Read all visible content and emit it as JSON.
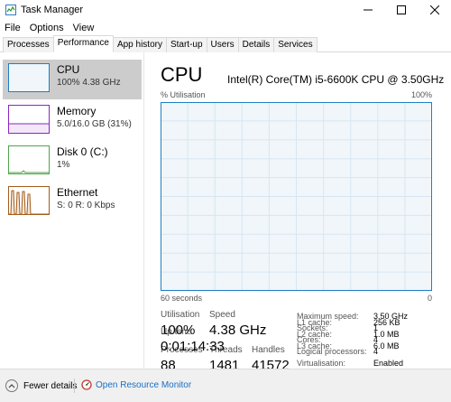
{
  "window": {
    "title": "Task Manager"
  },
  "menu": [
    "File",
    "Options",
    "View"
  ],
  "tabs": [
    {
      "label": "Processes"
    },
    {
      "label": "Performance",
      "active": true
    },
    {
      "label": "App history"
    },
    {
      "label": "Start-up"
    },
    {
      "label": "Users"
    },
    {
      "label": "Details"
    },
    {
      "label": "Services"
    }
  ],
  "sidebar": {
    "items": [
      {
        "name": "CPU",
        "sub": "100% 4.38 GHz",
        "color": "#1f7fc4",
        "selected": true
      },
      {
        "name": "Memory",
        "sub": "5.0/16.0 GB (31%)",
        "color": "#8b26c3"
      },
      {
        "name": "Disk 0 (C:)",
        "sub": "1%",
        "color": "#4ca64c"
      },
      {
        "name": "Ethernet",
        "sub": "S: 0 R: 0 Kbps",
        "color": "#a35c1c"
      }
    ]
  },
  "cpu": {
    "title": "CPU",
    "model": "Intel(R) Core(TM) i5-6600K CPU @ 3.50GHz",
    "util_label": "% Utilisation",
    "util_max": "100%",
    "time_left": "60 seconds",
    "time_right": "0",
    "graph_color": "#1f7fc4",
    "graph_fill": "#f1f6fa",
    "graph_grid": "#d7e6f2",
    "stats": {
      "utilisation_label": "Utilisation",
      "utilisation_value": "100%",
      "speed_label": "Speed",
      "speed_value": "4.38 GHz",
      "processes_label": "Processes",
      "processes_value": "88",
      "threads_label": "Threads",
      "threads_value": "1481",
      "handles_label": "Handles",
      "handles_value": "41572",
      "uptime_label": "Up time",
      "uptime_value": "0:01:14:33"
    },
    "specs": [
      {
        "label": "Maximum speed:",
        "value": "3.50 GHz"
      },
      {
        "label": "Sockets:",
        "value": "1"
      },
      {
        "label": "Cores:",
        "value": "4"
      },
      {
        "label": "Logical processors:",
        "value": "4"
      },
      {
        "label": "Virtualisation:",
        "value": "Enabled"
      },
      {
        "label": "L1 cache:",
        "value": "256 KB"
      },
      {
        "label": "L2 cache:",
        "value": "1.0 MB"
      },
      {
        "label": "L3 cache:",
        "value": "6.0 MB"
      }
    ]
  },
  "footer": {
    "fewer_details": "Fewer details",
    "resource_monitor": "Open Resource Monitor",
    "link_color": "#1a6fc4"
  }
}
